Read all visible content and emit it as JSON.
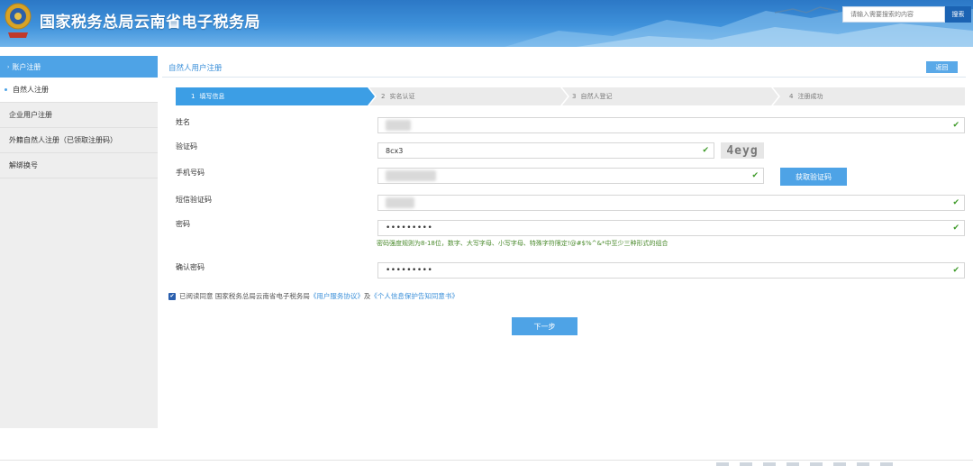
{
  "header": {
    "title": "国家税务总局云南省电子税务局",
    "search_placeholder": "请输入需要搜索的内容",
    "search_button": "搜索",
    "emblem_icon": "tax-emblem-icon"
  },
  "sidebar": {
    "section_title": "账户注册",
    "items": [
      {
        "label": "自然人注册",
        "active": true
      },
      {
        "label": "企业用户注册",
        "active": false
      },
      {
        "label": "外籍自然人注册（已领取注册码）",
        "active": false
      },
      {
        "label": "解绑换号",
        "active": false
      }
    ]
  },
  "main": {
    "page_title": "自然人用户注册",
    "back_button": "返回",
    "steps": [
      {
        "num": "1",
        "label": "填写信息",
        "active": true
      },
      {
        "num": "2",
        "label": "实名认证",
        "active": false
      },
      {
        "num": "3",
        "label": "自然人登记",
        "active": false
      },
      {
        "num": "4",
        "label": "注册成功",
        "active": false
      }
    ],
    "form": {
      "name_label": "姓名",
      "captcha_label": "验证码",
      "captcha_value": "8cx3",
      "captcha_image_text": "4eyg",
      "phone_label": "手机号码",
      "sms_button": "获取验证码",
      "sms_label": "短信验证码",
      "password_label": "密码",
      "password_value": "•••••••••",
      "password_hint": "密码强度规则为8-18位，数字、大写字母、小写字母、特殊字符限定!@#$%^&*中至少三种形式的组合",
      "confirm_label": "确认密码",
      "confirm_value": "•••••••••"
    },
    "agreement": {
      "prefix": "已阅读同意 国家税务总局云南省电子税务局",
      "link1": "《用户服务协议》",
      "middle": "及",
      "link2": "《个人信息保护告知同意书》"
    },
    "next_button": "下一步"
  },
  "colors": {
    "accent": "#4ea3e6",
    "active_step": "#3c9ee5",
    "check": "#3f9b2a",
    "header_dark": "#2c78c6"
  }
}
